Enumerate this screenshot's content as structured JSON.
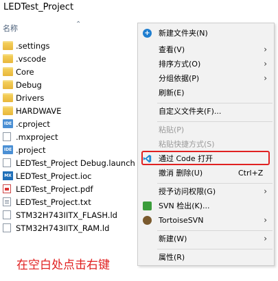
{
  "window": {
    "title": "LEDTest_Project"
  },
  "columns": {
    "name": "名称",
    "sort_icon": "sort-ascending-icon"
  },
  "files": [
    {
      "name": ".settings",
      "icon": "folder"
    },
    {
      "name": ".vscode",
      "icon": "folder"
    },
    {
      "name": "Core",
      "icon": "folder"
    },
    {
      "name": "Debug",
      "icon": "folder"
    },
    {
      "name": "Drivers",
      "icon": "folder"
    },
    {
      "name": "HARDWAVE",
      "icon": "folder"
    },
    {
      "name": ".cproject",
      "icon": "ide"
    },
    {
      "name": ".mxproject",
      "icon": "doc"
    },
    {
      "name": ".project",
      "icon": "ide"
    },
    {
      "name": "LEDTest_Project Debug.launch",
      "icon": "doc"
    },
    {
      "name": "LEDTest_Project.ioc",
      "icon": "mx"
    },
    {
      "name": "LEDTest_Project.pdf",
      "icon": "pdf"
    },
    {
      "name": "LEDTest_Project.txt",
      "icon": "txt"
    },
    {
      "name": "STM32H743IITX_FLASH.ld",
      "icon": "doc"
    },
    {
      "name": "STM32H743IITX_RAM.ld",
      "icon": "doc"
    }
  ],
  "context_menu": {
    "new_folder": "新建文件夹(N)",
    "view": "查看(V)",
    "sort_by": "排序方式(O)",
    "group_by": "分组依据(P)",
    "refresh": "刷新(E)",
    "customize_folder": "自定义文件夹(F)...",
    "paste": "粘贴(P)",
    "paste_shortcut": "粘贴快捷方式(S)",
    "open_with_code": "通过 Code 打开",
    "undo_delete": "撤消 删除(U)",
    "undo_shortcut": "Ctrl+Z",
    "grant_access": "授予访问权限(G)",
    "svn_checkout": "SVN 检出(K)...",
    "tortoise_svn": "TortoiseSVN",
    "new": "新建(W)",
    "properties": "属性(R)"
  },
  "annotation": "在空白处点击右键",
  "colors": {
    "highlight": "#e02020",
    "annotation": "#e02020",
    "menu_bg": "#f2f2f2"
  }
}
